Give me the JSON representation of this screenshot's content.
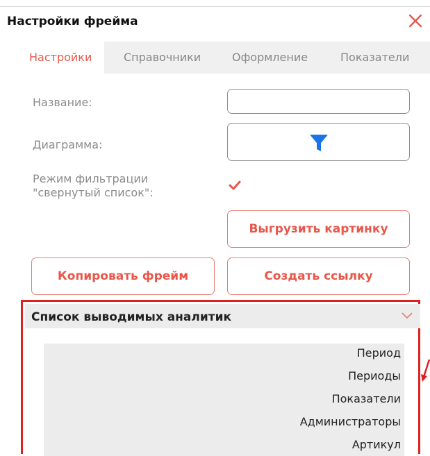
{
  "dialog": {
    "title": "Настройки фрейма"
  },
  "tabs": [
    {
      "label": "Настройки",
      "active": true
    },
    {
      "label": "Справочники",
      "active": false
    },
    {
      "label": "Оформление",
      "active": false
    },
    {
      "label": "Показатели",
      "active": false
    }
  ],
  "form": {
    "name_label": "Название:",
    "name_value": "",
    "chart_label": "Диаграмма:",
    "chart_icon": "funnel-icon",
    "filter_mode_label_line1": "Режим фильтрации",
    "filter_mode_label_line2": "\"свернутый список\":",
    "filter_mode_checked": true
  },
  "buttons": {
    "export_image": "Выгрузить картинку",
    "copy_frame": "Копировать фрейм",
    "create_link": "Создать ссылку"
  },
  "analytics_section": {
    "title": "Список выводимых аналитик",
    "items": [
      "Период",
      "Периоды",
      "Показатели",
      "Администраторы",
      "Артикул"
    ]
  },
  "colors": {
    "accent": "#e8574a",
    "highlight_border": "#e0201e",
    "funnel_blue": "#1a73e8"
  }
}
